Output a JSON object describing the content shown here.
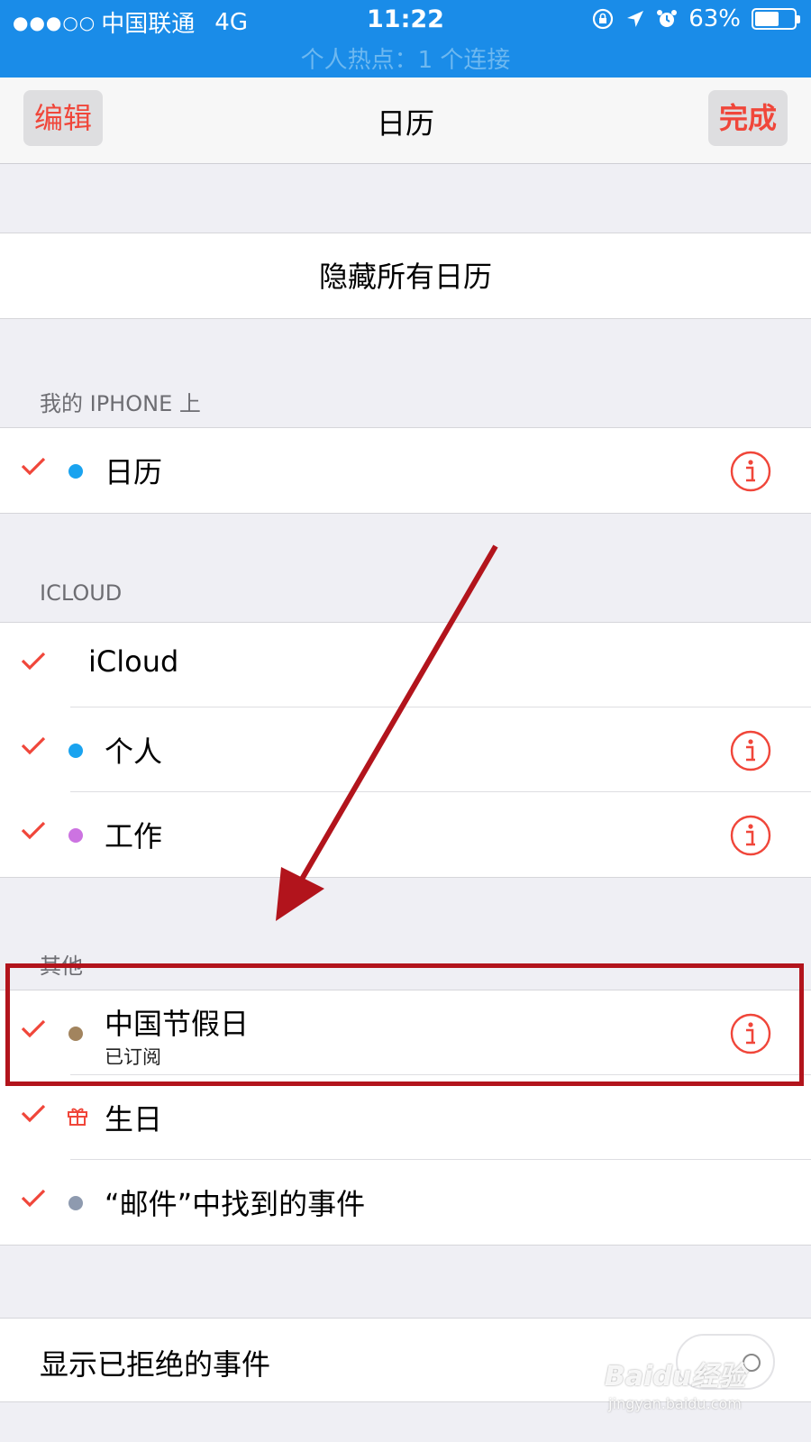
{
  "status_bar": {
    "signal_dots": "●●●○○",
    "carrier": "中国联通",
    "network": "4G",
    "time": "11:22",
    "battery_percent": "63%",
    "battery_level": 0.63,
    "hotspot": "个人热点：1 个连接"
  },
  "nav": {
    "edit_label": "编辑",
    "title": "日历",
    "done_label": "完成"
  },
  "hide_all_label": "隐藏所有日历",
  "sections": {
    "iphone": {
      "header": "我的 IPHONE 上",
      "items": [
        {
          "label": "日历",
          "dot_color": "#1aa3ef"
        }
      ]
    },
    "icloud": {
      "header": "ICLOUD",
      "items": [
        {
          "label": "iCloud"
        },
        {
          "label": "个人",
          "dot_color": "#1aa3ef"
        },
        {
          "label": "工作",
          "dot_color": "#cc73e1"
        }
      ]
    },
    "other": {
      "header": "其他",
      "items": [
        {
          "label": "中国节假日",
          "sub": "已订阅",
          "dot_color": "#a2845e"
        },
        {
          "label": "生日",
          "icon": "gift-icon"
        },
        {
          "label": "“邮件”中找到的事件",
          "dot_color": "#8e9aaf"
        }
      ]
    }
  },
  "show_declined": {
    "label": "显示已拒绝的事件",
    "enabled": false
  },
  "colors": {
    "status_bar": "#1a8ce8",
    "accent": "#f0463a",
    "annotation": "#b2141c"
  },
  "watermark": {
    "main": "Baidu经验",
    "sub": "jingyan.baidu.com"
  }
}
